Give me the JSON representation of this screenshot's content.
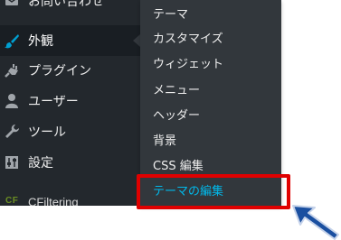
{
  "colors": {
    "sidebar_bg": "#23282d",
    "sidebar_active_bg": "#191e23",
    "submenu_bg": "#32373c",
    "submenu_text": "#eeeeee",
    "submenu_current": "#00b9eb",
    "highlight_red": "#e00000",
    "arrow_blue": "#1a4fa0"
  },
  "sidebar": {
    "items": [
      {
        "label": "お問い合わせ",
        "icon": "mail-icon"
      },
      {
        "label": "外観",
        "icon": "paintbrush-icon",
        "active": true
      },
      {
        "label": "プラグイン",
        "icon": "plugin-icon"
      },
      {
        "label": "ユーザー",
        "icon": "user-icon"
      },
      {
        "label": "ツール",
        "icon": "wrench-icon"
      },
      {
        "label": "設定",
        "icon": "settings-icon"
      },
      {
        "label": "CFiltering",
        "icon": "cf-icon",
        "badge": "CF"
      }
    ]
  },
  "submenu": {
    "items": [
      {
        "label": "テーマ"
      },
      {
        "label": "カスタマイズ"
      },
      {
        "label": "ウィジェット"
      },
      {
        "label": "メニュー"
      },
      {
        "label": "ヘッダー"
      },
      {
        "label": "背景"
      },
      {
        "label": "CSS 編集"
      },
      {
        "label": "テーマの編集",
        "current": true
      }
    ]
  },
  "annotation": {
    "highlight_target": "テーマの編集",
    "pointer": "arrow-pointer-icon"
  }
}
